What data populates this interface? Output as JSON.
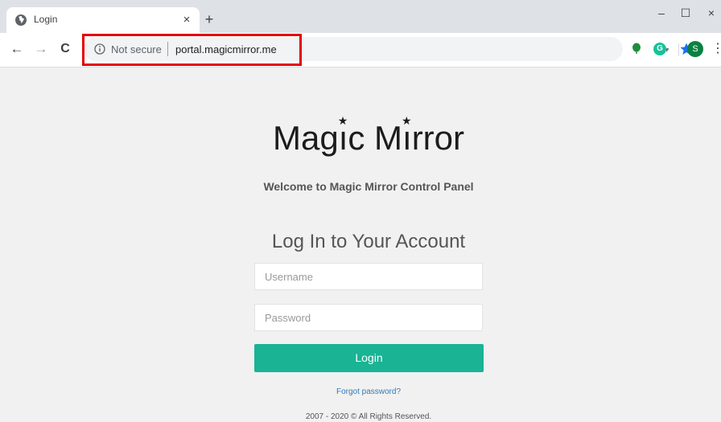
{
  "browser": {
    "tab": {
      "title": "Login",
      "close_glyph": "×"
    },
    "new_tab_glyph": "+",
    "window_controls": {
      "minimize": "–",
      "maximize": "☐",
      "close": "×"
    },
    "nav": {
      "back": "←",
      "forward": "→",
      "reload": "C"
    },
    "omnibox": {
      "security_label": "Not secure",
      "url": "portal.magicmirror.me"
    },
    "extension_letter": "G",
    "profile_initial": "S",
    "menu_glyph": "⋮",
    "colors": {
      "accent_blue": "#1a73e8",
      "highlight_red": "#e60000",
      "profile_green": "#0b8043"
    }
  },
  "page": {
    "logo": {
      "part1": "Mag",
      "part2": "c M",
      "part3": "rror"
    },
    "welcome": "Welcome to Magic Mirror Control Panel",
    "heading": "Log In to Your Account",
    "username_placeholder": "Username",
    "password_placeholder": "Password",
    "login_label": "Login",
    "forgot_label": "Forgot password?",
    "copyright": "2007 - 2020 © All Rights Reserved.",
    "colors": {
      "primary_button": "#1ab394",
      "link": "#337ab7"
    }
  }
}
